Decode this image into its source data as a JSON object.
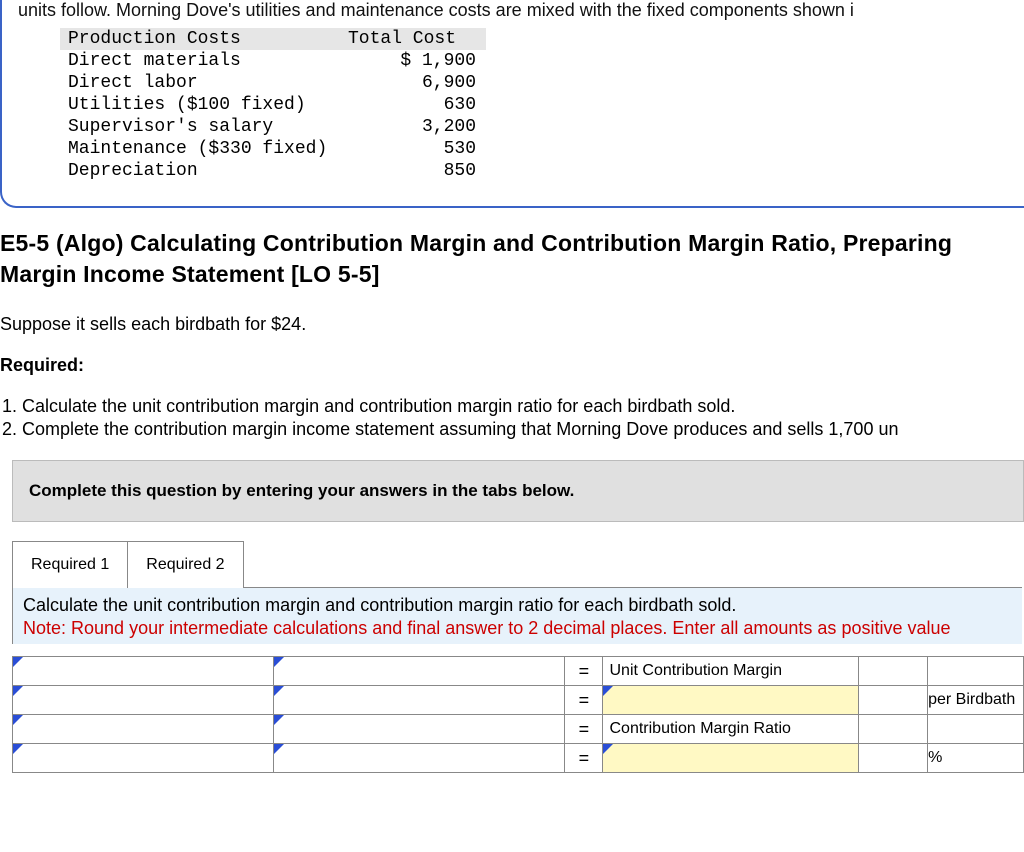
{
  "top_fragments": {
    "cutoff_line": "units follow. Morning Dove's utilities and maintenance costs are mixed with the fixed components shown i"
  },
  "cost_table": {
    "headers": {
      "label": "Production Costs",
      "total": "Total Cost"
    },
    "rows": [
      {
        "label": "Direct materials",
        "value": "$ 1,900"
      },
      {
        "label": "Direct labor",
        "value": "6,900"
      },
      {
        "label": "Utilities ($100 fixed)",
        "value": "630"
      },
      {
        "label": "Supervisor's salary",
        "value": "3,200"
      },
      {
        "label": "Maintenance ($330 fixed)",
        "value": "530"
      },
      {
        "label": "Depreciation",
        "value": "850"
      }
    ]
  },
  "heading": "E5-5 (Algo) Calculating Contribution Margin and Contribution Margin Ratio, Preparing Margin Income Statement [LO 5-5]",
  "suppose_line": "Suppose it sells each birdbath for $24.",
  "required_label": "Required:",
  "required_items": [
    "Calculate the unit contribution margin and contribution margin ratio for each birdbath sold.",
    "Complete the contribution margin income statement assuming that Morning Dove produces and sells 1,700 un"
  ],
  "instruction_bar": "Complete this question by entering your answers in the tabs below.",
  "tabs": {
    "items": [
      "Required 1",
      "Required 2"
    ],
    "active": 0
  },
  "panel": {
    "line1": "Calculate the unit contribution margin and contribution margin ratio for each birdbath sold.",
    "line2": "Note: Round your intermediate calculations and final answer to 2 decimal places. Enter all amounts as positive value"
  },
  "worksheet": {
    "rows": [
      {
        "a": "",
        "b": "",
        "eq": "=",
        "desc": "Unit Contribution Margin",
        "val": "",
        "unit": "",
        "desc_yellow": false
      },
      {
        "a": "",
        "b": "",
        "eq": "=",
        "desc": "",
        "val": "",
        "unit": "per Birdbath",
        "desc_yellow": true
      },
      {
        "a": "",
        "b": "",
        "eq": "=",
        "desc": "Contribution Margin Ratio",
        "val": "",
        "unit": "",
        "desc_yellow": false
      },
      {
        "a": "",
        "b": "",
        "eq": "=",
        "desc": "",
        "val": "",
        "unit": "%",
        "desc_yellow": true
      }
    ]
  }
}
